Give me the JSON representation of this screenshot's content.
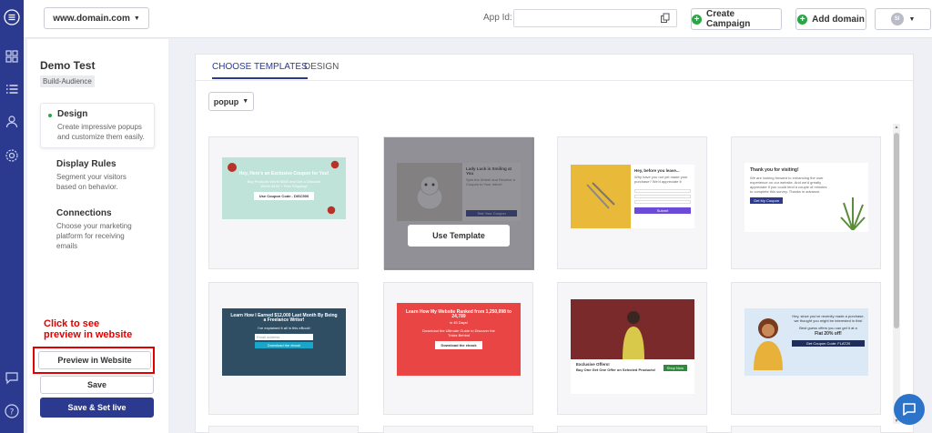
{
  "topbar": {
    "domain": "www.domain.com",
    "app_id_label": "App Id:",
    "app_id_value": "",
    "create_campaign": "Create Campaign",
    "add_domain": "Add domain",
    "user_initials": "SI"
  },
  "sidebar": {
    "title": "Demo Test",
    "badge": "Build-Audience",
    "steps": [
      {
        "title": "Design",
        "desc": "Create impressive popups and customize them easily."
      },
      {
        "title": "Display Rules",
        "desc": "Segment your visitors based on behavior."
      },
      {
        "title": "Connections",
        "desc": "Choose your marketing platform for receiving emails"
      }
    ],
    "annotation_line1": "Click to see",
    "annotation_line2": "preview in website",
    "preview_button": "Preview in Website",
    "save_button": "Save",
    "save_live_button": "Save & Set live"
  },
  "main": {
    "tabs": [
      {
        "label": "CHOOSE TEMPLATES"
      },
      {
        "label": "DESIGN"
      }
    ],
    "dropdown": "popup",
    "use_template": "Use Template",
    "templates": [
      {
        "headline": "Hey, Here's an Exclusive Coupon for You!",
        "body": "Buy Products Worth $500 and Get a Discount Worth $100 + Free Shipping!",
        "cta": "Use Coupon Code - DISC500"
      },
      {
        "headline": "Lady Luck is Smiling at You",
        "body": "Spin the Wheel and Receive a Coupon to Your Inbox!",
        "cta": "Test Your Coupon"
      },
      {
        "headline": "Hey, before you leave...",
        "body": "Why have you not yet made your purchase? We'd appreciate it",
        "cta": "Submit"
      },
      {
        "headline": "Thank you for visiting!",
        "body": "We are looking forward to enhancing the user experience on our website. And we'd greatly appreciate if you could lend a couple of minutes to complete this survey. Thanks in advance.",
        "cta": "Get My Coupon"
      },
      {
        "headline": "Learn How I Earned $12,000 Last Month By Being a Freelance Writer!",
        "body": "I've explained it all in this eBook!",
        "input": "Email address",
        "cta": "Download the ebook"
      },
      {
        "headline": "Learn How My Website Ranked from 1,250,098 to 24,789",
        "sub": "in 45 Days!",
        "body": "Download the Ultimate Guide to Discover the Tricks Behind",
        "cta": "Download the ebook"
      },
      {
        "headline": "Exclusive Offers!",
        "body": "Buy One Get One Offer on Selected Products!",
        "cta": "Shop Now"
      },
      {
        "headline": "Hey, since you've recently made a purchase, we thought you might be interested in this!",
        "body": "Best guess offers you can get it at a",
        "highlight": "Flat 20% off!",
        "cta": "Get Coupon Code: FLAT20"
      }
    ]
  },
  "colors": {
    "brand": "#2b3a8f",
    "accent_green": "#28a745",
    "annotation_red": "#e00000"
  }
}
